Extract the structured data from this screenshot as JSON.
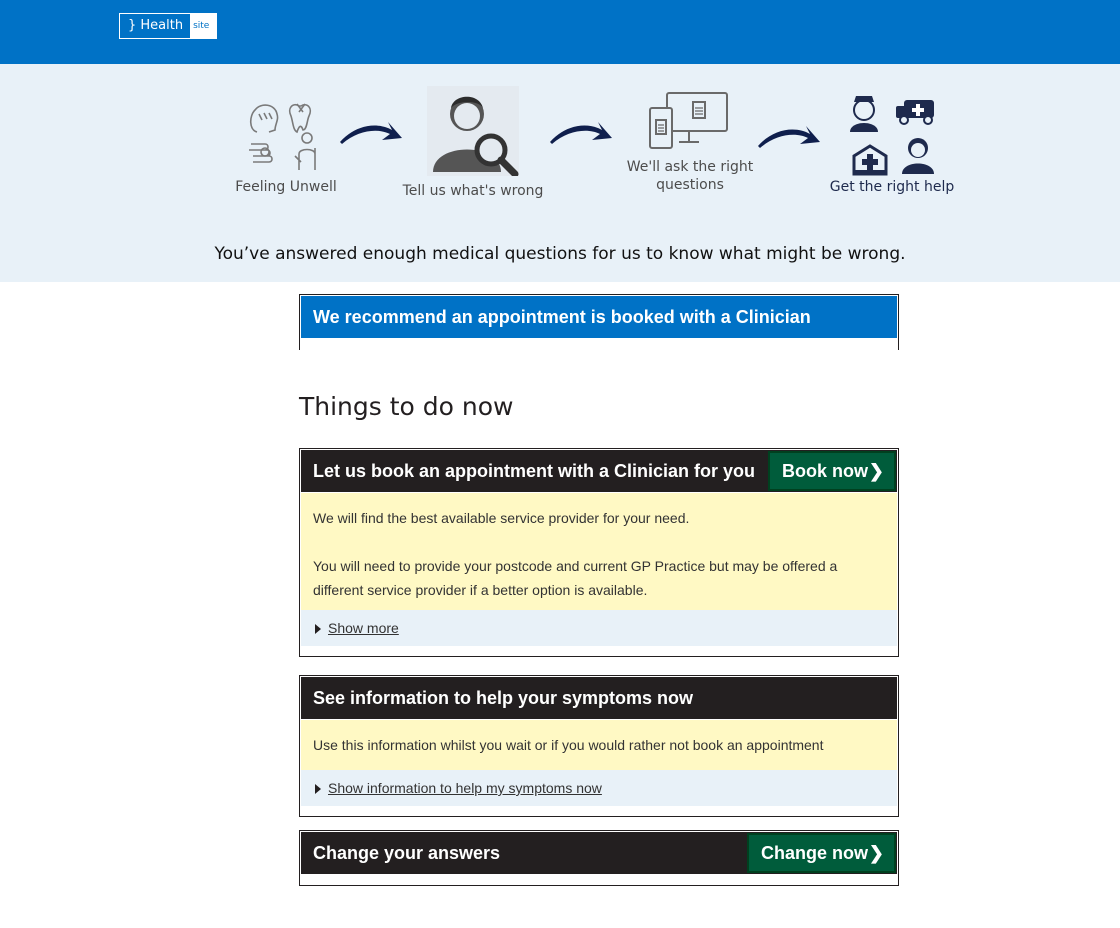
{
  "header": {
    "logo_main": "} Health",
    "logo_sub": "site",
    "color": "#0072c6"
  },
  "steps": [
    {
      "label": "Feeling Unwell"
    },
    {
      "label": "Tell us what's wrong"
    },
    {
      "label": "We'll ask the right questions"
    },
    {
      "label": "Get the right help"
    }
  ],
  "hero_message": "You’ve answered enough medical questions for us to know what might be wrong.",
  "recommendation": "We recommend an appointment is booked with a Clinician",
  "section_title": "Things to do now",
  "cards": {
    "book": {
      "title": "Let us book an appointment with a Clinician for you",
      "cta": "Book now",
      "body1": "We will find the best available service provider for your need.",
      "body2": "You will need to provide your postcode and current GP Practice but may be offered a different service provider if a better option is available.",
      "toggle": "Show more"
    },
    "info": {
      "title": "See information to help your symptoms now",
      "body": "Use this information whilst you wait or if you would rather not book an appointment",
      "toggle": "Show information to help my symptoms now"
    },
    "change": {
      "title": "Change your answers",
      "cta": "Change now"
    }
  },
  "colors": {
    "brand_blue": "#0072c6",
    "dark": "#231f20",
    "cta_green": "#005c3b",
    "note_yellow": "#fff9c4",
    "light_blue": "#e8f1f8"
  },
  "icons": [
    "symptoms-collage-icon",
    "arrow-right-icon",
    "user-search-icon",
    "devices-clipboard-icon",
    "clinicians-collage-icon",
    "chevron-right-icon",
    "triangle-right-icon"
  ]
}
